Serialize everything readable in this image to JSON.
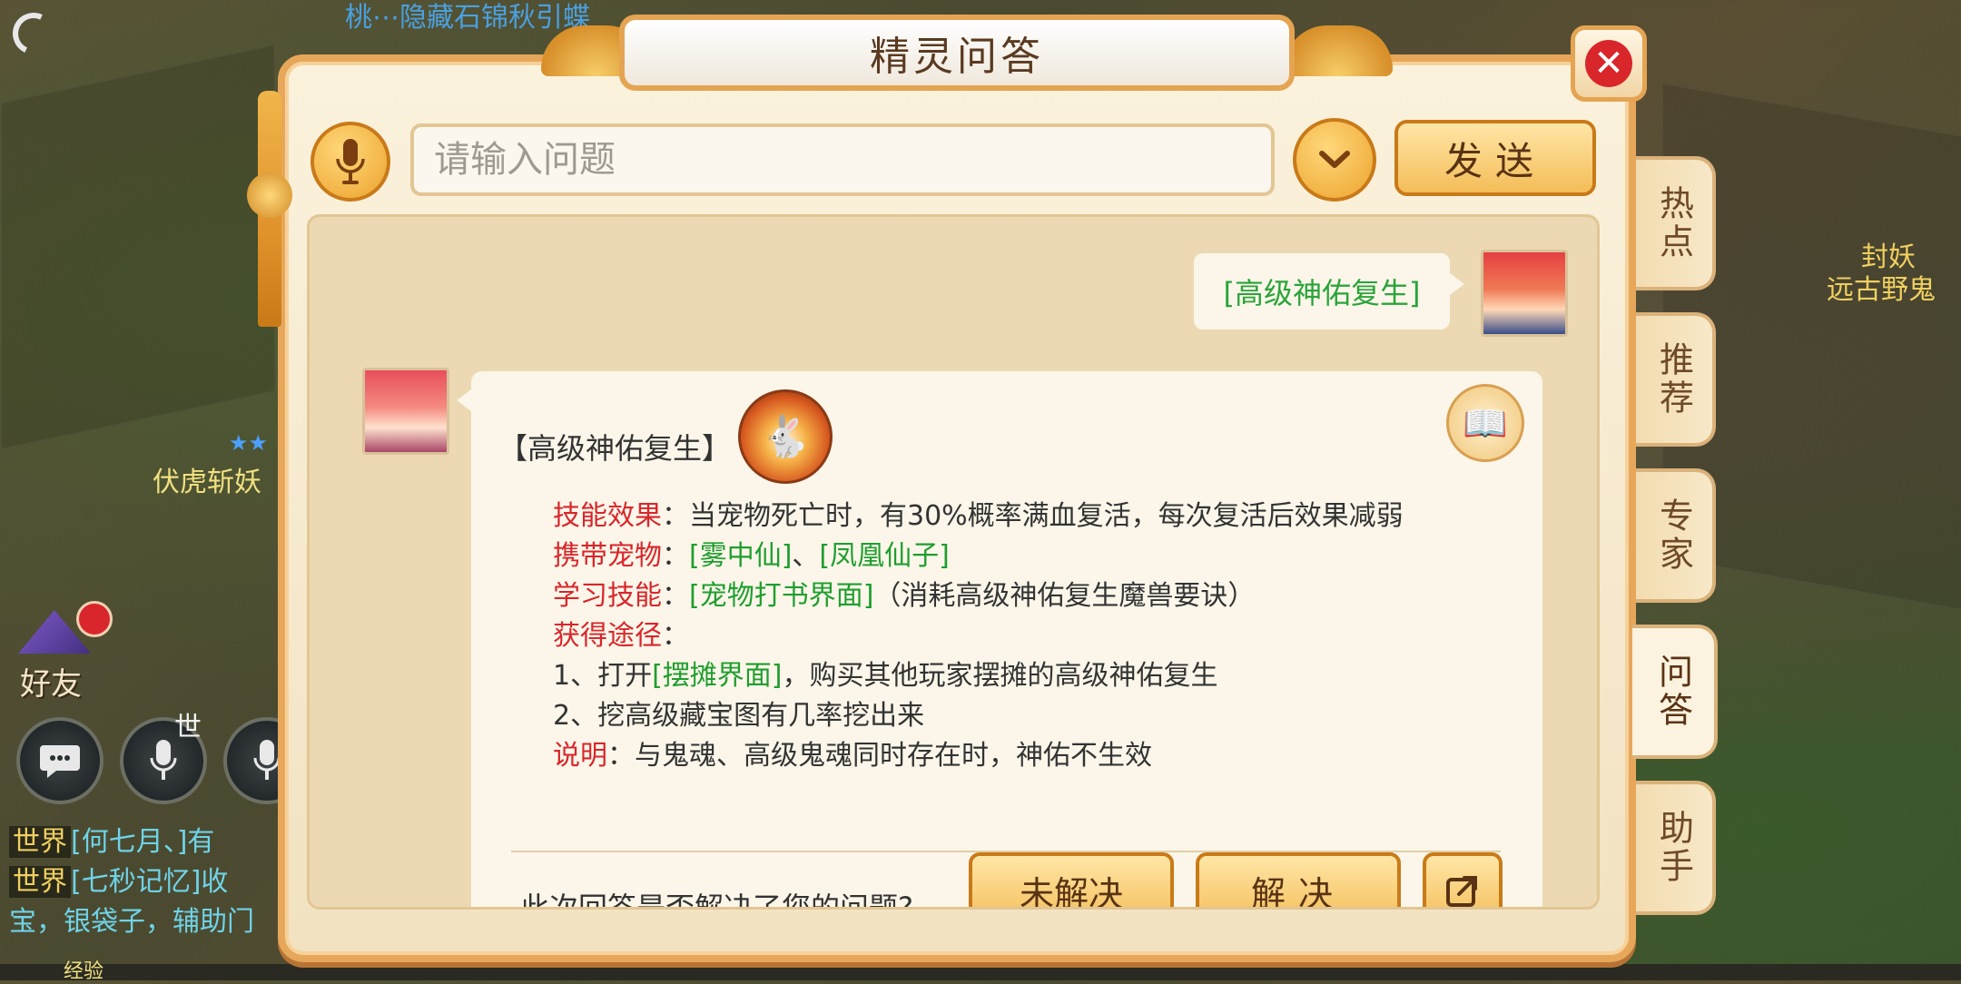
{
  "game": {
    "top_text": "桃⋯隐藏石锦秋引蝶",
    "stars": "★★",
    "npc_left": "伏虎斩妖",
    "npc_right_top": "封妖",
    "npc_right": "远古野鬼",
    "friends_label": "好友",
    "world_voice_label": "世",
    "chat": [
      {
        "channel": "世界",
        "text": "[何七月、]有"
      },
      {
        "channel": "世界",
        "text": "[七秒记忆]收"
      },
      {
        "channel": "",
        "text": "宝，银袋子，辅助门"
      }
    ],
    "exp_label": "经验"
  },
  "dialog": {
    "title": "精灵问答",
    "close_label": "✕",
    "input_placeholder": "请输入问题",
    "send_label": "发送",
    "user_question": "[高级神佑复生]",
    "answer": {
      "skill_title": "【高级神佑复生】",
      "effect_label": "技能效果",
      "effect_text": "：当宠物死亡时，有30%概率满血复活，每次复活后效果减弱",
      "pet_label": "携带宠物",
      "pet_sep": "：",
      "pet_1": "[雾中仙]",
      "pet_and": "、",
      "pet_2": "[凤凰仙子]",
      "learn_label": "学习技能",
      "learn_sep": "：",
      "learn_link": "[宠物打书界面]",
      "learn_text": "（消耗高级神佑复生魔兽要诀）",
      "obtain_label": "获得途径",
      "obtain_sep": "：",
      "way1_prefix": "1、打开",
      "way1_link": "[摆摊界面]",
      "way1_text": "，购买其他玩家摆摊的高级神佑复生",
      "way2": "2、挖高级藏宝图有几率挖出来",
      "note_label": "说明",
      "note_text": "：与鬼魂、高级鬼魂同时存在时，神佑不生效"
    },
    "feedback_question": "此次回答是否解决了您的问题?",
    "unsolved_label": "未解决",
    "solved_label": "解决"
  },
  "tabs": [
    {
      "label": "热点",
      "active": false
    },
    {
      "label": "推荐",
      "active": false
    },
    {
      "label": "专家",
      "active": false
    },
    {
      "label": "问答",
      "active": true
    },
    {
      "label": "助手",
      "active": false
    }
  ],
  "colors": {
    "accent": "#f4bd58",
    "link_green": "#1f9e2f",
    "label_red": "#d9262b"
  }
}
